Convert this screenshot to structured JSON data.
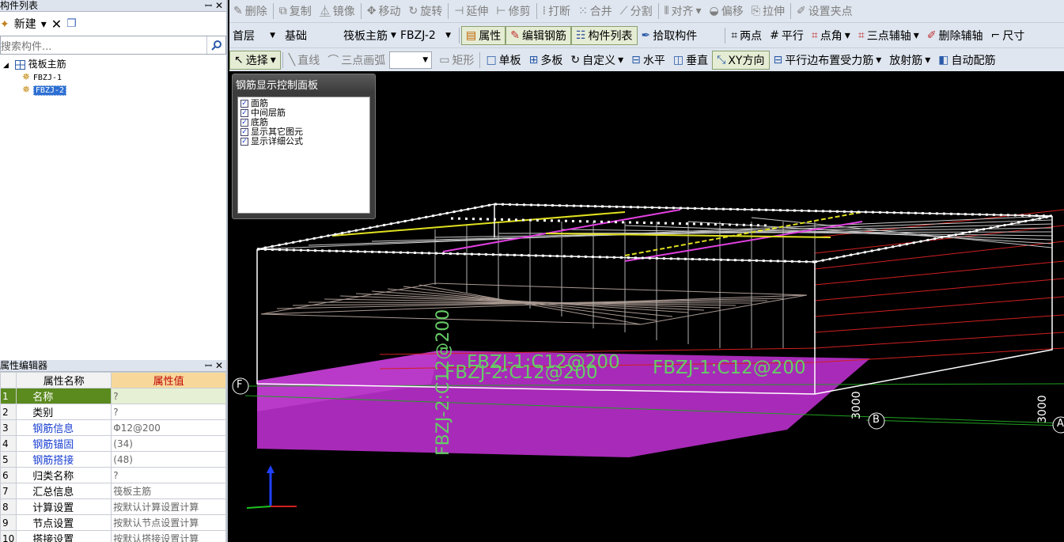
{
  "left_panel": {
    "component_list_title": "构件列表",
    "new_label": "新建",
    "search_placeholder": "搜索构件...",
    "tree_root": "筏板主筋",
    "tree_items": [
      "FBZJ-1",
      "FBZJ-2"
    ],
    "property_editor_title": "属性编辑器",
    "col_name": "属性名称",
    "col_value": "属性值",
    "properties": [
      {
        "n": "1",
        "name": "名称",
        "value": "?"
      },
      {
        "n": "2",
        "name": "类别",
        "value": "?"
      },
      {
        "n": "3",
        "name": "钢筋信息",
        "value": "Φ12@200"
      },
      {
        "n": "4",
        "name": "钢筋锚固",
        "value": "(34)"
      },
      {
        "n": "5",
        "name": "钢筋搭接",
        "value": "(48)"
      },
      {
        "n": "6",
        "name": "归类名称",
        "value": "?"
      },
      {
        "n": "7",
        "name": "汇总信息",
        "value": "筏板主筋"
      },
      {
        "n": "8",
        "name": "计算设置",
        "value": "按默认计算设置计算"
      },
      {
        "n": "9",
        "name": "节点设置",
        "value": "按默认节点设置计算"
      },
      {
        "n": "10",
        "name": "搭接设置",
        "value": "按默认搭接设置计算"
      }
    ]
  },
  "toolbar1": [
    "删除",
    "复制",
    "镜像",
    "移动",
    "旋转",
    "延伸",
    "修剪",
    "打断",
    "合并",
    "分割",
    "对齐",
    "偏移",
    "拉伸",
    "设置夹点"
  ],
  "toolbar2": {
    "floor": "首层",
    "category": "基础",
    "type": "筏板主​筋",
    "component": "FBZJ-2",
    "buttons": [
      "属性",
      "编辑钢筋",
      "构件列表",
      "拾取构件"
    ],
    "axis_buttons": [
      "两点",
      "平行",
      "点角",
      "三点辅轴",
      "删除辅轴",
      "尺寸"
    ]
  },
  "toolbar3": [
    "选择",
    "直线",
    "三点画弧",
    "矩形",
    "单板",
    "多板",
    "自定义",
    "水平",
    "垂直",
    "XY方向",
    "平行边布置受力筋",
    "放射筋",
    "自动配筋"
  ],
  "viewport": {
    "control_panel_title": "钢筋显示控制面板",
    "checkboxes": [
      "面筋",
      "中间层筋",
      "底筋",
      "显示其它图元",
      "显示详细公式"
    ],
    "labels": {
      "l1": "FBZJ-1:C12@200",
      "l2": "FBZJ-2:C12@200",
      "l3": "FBZJ-1:C12@200",
      "l4": "FBZJ-2:C12@200",
      "axis_f": "F",
      "axis_b": "B",
      "axis_a": "A",
      "dim1": "3000",
      "dim2": "3000"
    }
  }
}
